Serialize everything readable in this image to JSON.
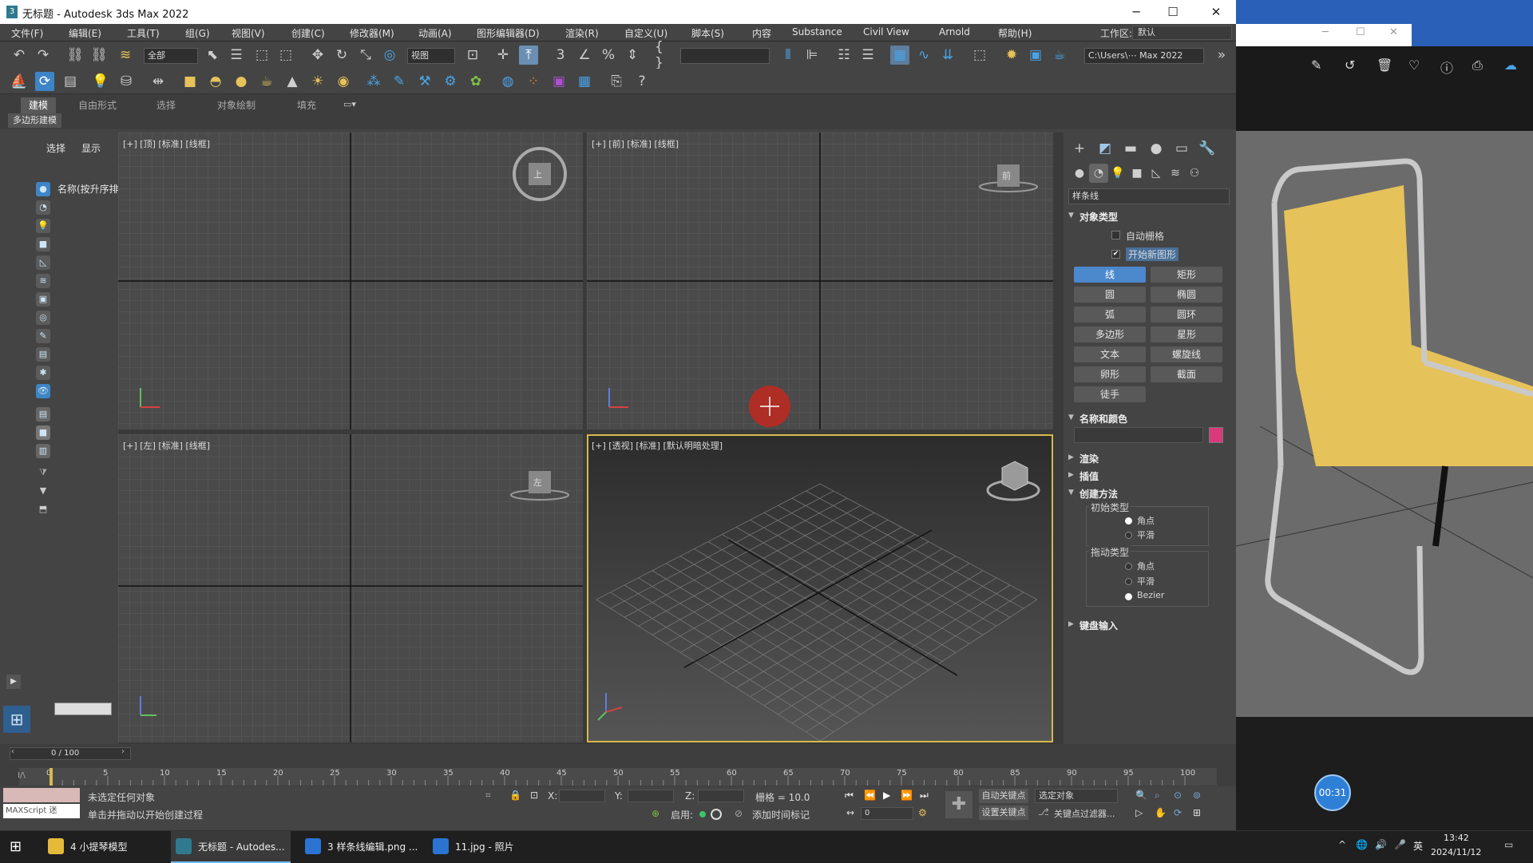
{
  "app": {
    "title": "无标题 - Autodesk 3ds Max 2022",
    "window_icon": "3",
    "minimize": "─",
    "maximize": "☐",
    "close": "✕"
  },
  "menu": [
    "文件(F)",
    "编辑(E)",
    "工具(T)",
    "组(G)",
    "视图(V)",
    "创建(C)",
    "修改器(M)",
    "动画(A)",
    "图形编辑器(D)",
    "渲染(R)",
    "自定义(U)",
    "脚本(S)",
    "内容",
    "Substance",
    "Civil View",
    "Arnold",
    "帮助(H)"
  ],
  "workspace": {
    "label": "工作区:",
    "value": "默认"
  },
  "toolbar": {
    "filter_value": "全部",
    "ref_coord": "视图",
    "named_selection": "",
    "project_path": "C:\\Users\\⋯ Max 2022"
  },
  "ribbon": {
    "tabs": [
      "建模",
      "自由形式",
      "选择",
      "对象绘制",
      "填充"
    ],
    "active_tab": "建模",
    "sub_label": "多边形建模"
  },
  "scene_explorer": {
    "tab_select": "选择",
    "tab_display": "显示",
    "column_header": "名称(按升序排"
  },
  "viewports": {
    "top": "[+] [顶] [标准] [线框]",
    "front": "[+] [前] [标准] [线框]",
    "left": "[+] [左] [标准] [线框]",
    "persp": "[+] [透视] [标准] [默认明暗处理]",
    "cube_top": "上",
    "cube_front": "前",
    "cube_left": "左"
  },
  "command_panel": {
    "category_dropdown": "样条线",
    "object_type": {
      "header": "对象类型",
      "auto_grid": "自动栅格",
      "start_new_shape": "开始新图形",
      "buttons": [
        "线",
        "矩形",
        "圆",
        "椭圆",
        "弧",
        "圆环",
        "多边形",
        "星形",
        "文本",
        "螺旋线",
        "卵形",
        "截面",
        "徒手"
      ]
    },
    "name_color": {
      "header": "名称和颜色",
      "color": "#d83a7c"
    },
    "render": "渲染",
    "interpolation": "插值",
    "creation_method": {
      "header": "创建方法",
      "initial_type": "初始类型",
      "initial_options": [
        "角点",
        "平滑"
      ],
      "drag_type": "拖动类型",
      "drag_options": [
        "角点",
        "平滑",
        "Bezier"
      ]
    },
    "keyboard_input": "键盘输入"
  },
  "timeline": {
    "frame_counter": "0 / 100",
    "ticks": [
      "0",
      "5",
      "10",
      "15",
      "20",
      "25",
      "30",
      "35",
      "40",
      "45",
      "50",
      "55",
      "60",
      "65",
      "70",
      "75",
      "80",
      "85",
      "90",
      "95",
      "100"
    ]
  },
  "status": {
    "maxscript": "MAXScript 迷",
    "line1": "未选定任何对象",
    "line2": "单击并拖动以开始创建过程",
    "x_label": "X:",
    "y_label": "Y:",
    "z_label": "Z:",
    "grid": "栅格 = 10.0",
    "enable": "启用:",
    "add_time_tag": "添加时间标记",
    "auto_key": "自动关键点",
    "set_key": "设置关键点",
    "selected_object": "选定对象",
    "key_filters": "关键点过滤器...",
    "frame_field": "0"
  },
  "photo_viewer": {
    "timer": "00:31"
  },
  "taskbar": {
    "items": [
      "4 小提琴模型",
      "无标题 - Autodes...",
      "3 样条线编辑.png ...",
      "11.jpg - 照片"
    ],
    "ime": "英",
    "time": "13:42",
    "date": "2024/11/12"
  },
  "colors": {
    "accent": "#4c88cc",
    "active_viewport": "#d6b94e",
    "chair_seat": "#e6c25a"
  }
}
